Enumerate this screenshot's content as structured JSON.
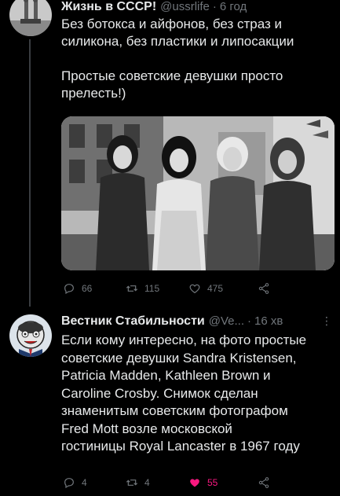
{
  "tweets": [
    {
      "name": "Жизнь в СССР!",
      "handle": "@ussrlife",
      "time": "6 год",
      "text": "Без ботокса и айфонов, без страз и\nсиликона, без пластики и липосакции\n\nПростые советские девушки просто\nпрелесть!)",
      "has_photo": true,
      "actions": {
        "reply": "66",
        "retweet": "115",
        "like": "475"
      }
    },
    {
      "name": "Вестник Стабильности",
      "handle": "@Ve...",
      "time": "16 хв",
      "text": "Если кому интересно, на фото простые\nсоветские девушки Sandra Kristensen,\nPatricia Madden, Kathleen Brown и\nCaroline Crosby. Снимок сделан\nзнаменитым советским фотографом\nFred Mott возле московской\nгостиницы Royal Lancaster в 1967 году",
      "actions": {
        "reply": "4",
        "retweet": "4",
        "like": "55"
      }
    }
  ],
  "icons": [
    "reply-icon",
    "retweet-icon",
    "like-icon",
    "share-icon",
    "more-icon"
  ],
  "colors": {
    "background": "#000000",
    "muted": "#71767b",
    "like_active": "#f91880",
    "text": "#e7e9ea"
  }
}
